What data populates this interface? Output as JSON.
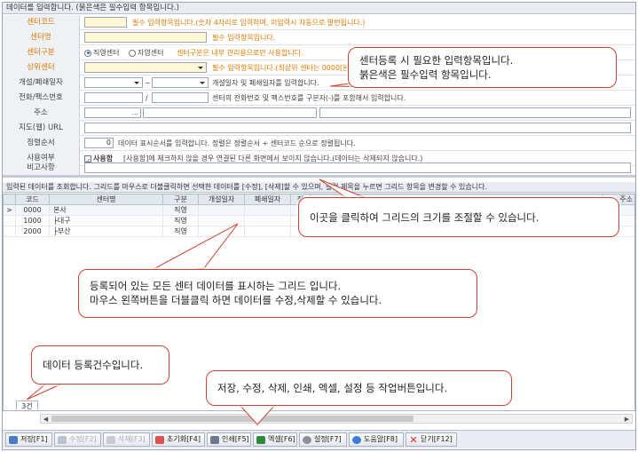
{
  "header": {
    "text": "데이터를 입력합니다. (붉은색은 필수입력 항목입니다.)"
  },
  "form": {
    "center_code": {
      "label": "센터코드",
      "value": "",
      "note": "필수 입력항목입니다.(숫자 4자리로 입력하며, 미입력시 자동으로 발번됩니다.)"
    },
    "center_name": {
      "label": "센터명",
      "value": "",
      "note": "필수 입력항목입니다."
    },
    "center_type": {
      "label": "센터구분",
      "option1": "직영센터",
      "option2": "자영센터",
      "note": "센터구분은 내부 관리용으로만 사용합니다."
    },
    "parent_center": {
      "label": "상위센터",
      "value": "",
      "note": "필수 입력항목입니다.(최상위 센터는 0000[본사]입니다.)"
    },
    "open_close": {
      "label": "개설/폐쇄일자",
      "tilde": "~",
      "note": "개설일자 및 폐쇄일자를 입력합니다."
    },
    "phone_fax": {
      "label": "전화/팩스번호",
      "slash": "/",
      "note": "센터의 전화번호 및 팩스번호를 구분자(-)를 포함해서 입력합니다."
    },
    "address": {
      "label": "주소",
      "btn": "..."
    },
    "map_url": {
      "label": "지도(웹) URL"
    },
    "sort_order": {
      "label": "정렬순서",
      "value": "0",
      "note": "데이터 표시순서를 입력합니다. 정렬은 정렬순서 + 센터코드 순으로 정렬됩니다."
    },
    "in_use": {
      "label": "사용여부",
      "check_label": "사용함",
      "note": "[사용함]에 체크하지 않을 경우 연결된 다른 화면에서 보이지 않습니다.(데이터는 삭제되지 않습니다.)"
    },
    "remarks": {
      "label": "비고사항"
    }
  },
  "grid": {
    "header_text": "입력된 데이터를 조회합니다. 그리드를 마우스로 더블클릭하면 선택한 데이터를 [수정], [삭제]할 수 있으며, 컬럼 제목을 누르면 그리드 항목을 변경할 수 있습니다.",
    "columns": [
      "코드",
      "센터명",
      "구분",
      "개설일자",
      "폐쇄일자",
      "정",
      "",
      "",
      "",
      "주소"
    ],
    "rows": [
      {
        "marker": ">",
        "code": "0000",
        "name": "본사",
        "type": "직영"
      },
      {
        "marker": "",
        "code": "1000",
        "name": "├대구",
        "type": "직영"
      },
      {
        "marker": "",
        "code": "2000",
        "name": "├부산",
        "type": "직영"
      }
    ],
    "count": "3건"
  },
  "toolbar": {
    "buttons": [
      {
        "label": "저장[F1]",
        "icon": "save-icon",
        "disabled": false
      },
      {
        "label": "수정[F2]",
        "icon": "edit-icon",
        "disabled": true
      },
      {
        "label": "삭제[F3]",
        "icon": "delete-icon",
        "disabled": true
      },
      {
        "label": "초기화[F4]",
        "icon": "reset-icon",
        "disabled": false
      },
      {
        "label": "인쇄[F5]",
        "icon": "print-icon",
        "disabled": false
      },
      {
        "label": "엑셀[F6]",
        "icon": "excel-icon",
        "disabled": false
      },
      {
        "label": "설정[F7]",
        "icon": "settings-icon",
        "disabled": false
      },
      {
        "label": "도움말[F8]",
        "icon": "help-icon",
        "disabled": false
      },
      {
        "label": "닫기[F12]",
        "icon": "close-icon",
        "disabled": false
      }
    ]
  },
  "callouts": {
    "required": {
      "line1": "센터등록 시 필요한 입력항목입니다.",
      "line2": "붉은색은 필수입력 항목입니다."
    },
    "resize": {
      "text": "이곳을 클릭하여 그리드의 크기를 조절할 수 있습니다."
    },
    "grid": {
      "line1": "등록되어 있는 모든 센터 데이터를 표시하는 그리드 입니다.",
      "line2": "마우스 왼쪽버튼을 더블클릭 하면 데이터를 수정,삭제할 수 있습니다."
    },
    "count": {
      "text": "데이터 등록건수입니다."
    },
    "toolbar": {
      "text": "저장, 수정, 삭제, 인쇄, 엑셀, 설정 등 작업버튼입니다."
    }
  },
  "colors": {
    "required_label": "#e07b00",
    "required_input": "#fff7d6",
    "callout_border": "#cc4433"
  }
}
